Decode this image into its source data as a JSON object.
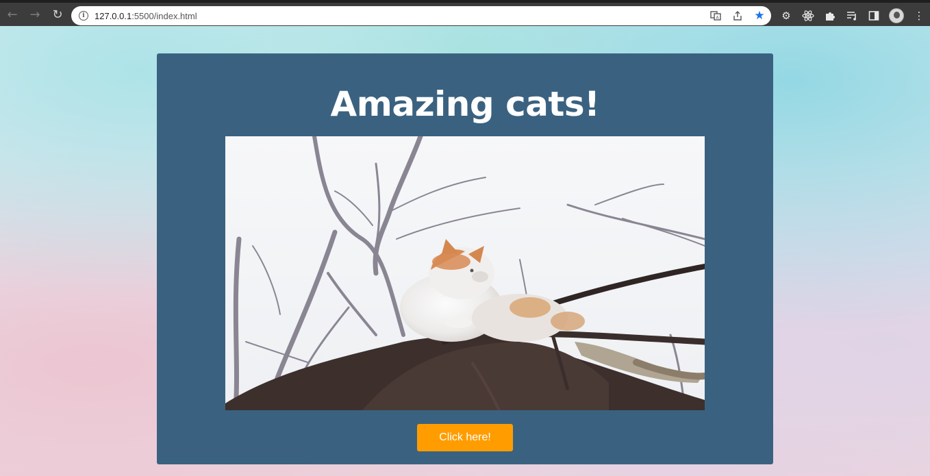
{
  "browser": {
    "url_host": "127.0.0.1",
    "url_rest": ":5500/index.html",
    "icons": {
      "back": "arrow-left-icon",
      "forward": "arrow-right-icon",
      "reload": "reload-icon",
      "site_info": "info-icon",
      "translate": "translate-icon",
      "share": "share-icon",
      "bookmark": "star-icon",
      "extension_1": "gear-icon",
      "extension_2": "react-icon",
      "extensions": "puzzle-icon",
      "reading_list": "reading-list-icon",
      "side_panel": "side-panel-icon",
      "profile": "avatar",
      "menu": "kebab-menu-icon"
    },
    "accent_color": "#1a73e8"
  },
  "page": {
    "title": "Amazing cats!",
    "image_alt": "",
    "button_label": "Click here!",
    "colors": {
      "card": "#3a6280",
      "button": "#ff9d00",
      "title": "#ffffff"
    }
  }
}
